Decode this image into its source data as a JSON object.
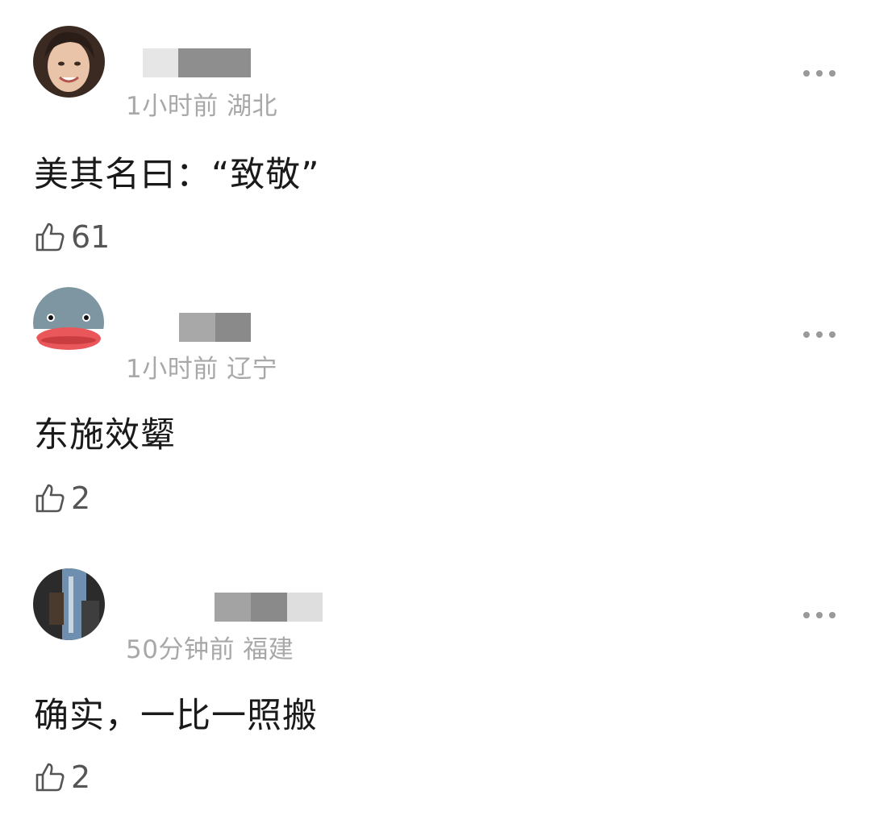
{
  "comments": [
    {
      "meta": "1小时前 湖北",
      "text": "美其名曰：“致敬”",
      "likes": "61",
      "avatar": "woman-avatar"
    },
    {
      "meta": "1小时前 辽宁",
      "text": "东施效颦",
      "likes": "2",
      "avatar": "cartoon-fish-avatar"
    },
    {
      "meta": "50分钟前 福建",
      "text": "确实，一比一照搬",
      "likes": "2",
      "avatar": "street-photo-avatar"
    }
  ],
  "icons": {
    "like": "thumbs-up-icon",
    "more": "more-dots-icon"
  },
  "colors": {
    "meta": "#a8a8a8",
    "text": "#1a1a1a",
    "icon": "#555555"
  }
}
